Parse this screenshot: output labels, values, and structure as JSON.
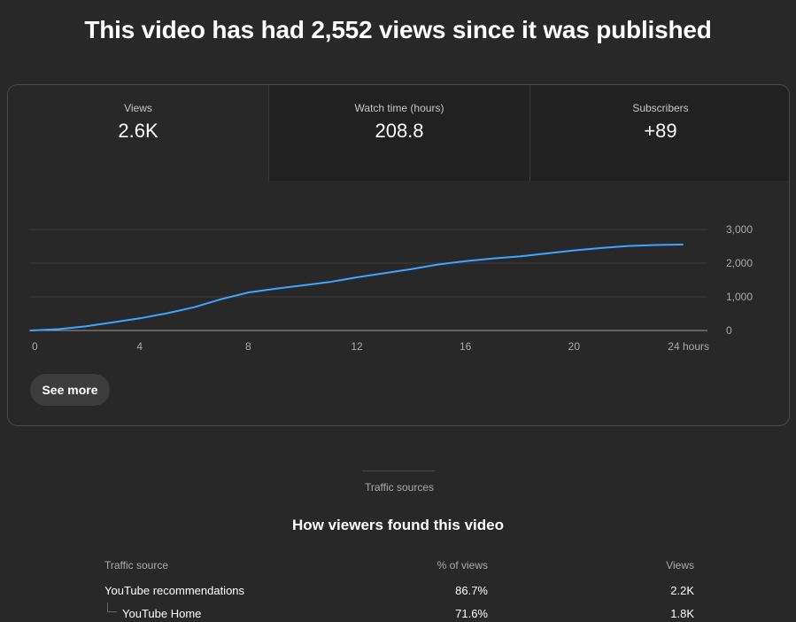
{
  "page_title": "This video has had 2,552 views since it was published",
  "metrics": [
    {
      "label": "Views",
      "value": "2.6K"
    },
    {
      "label": "Watch time (hours)",
      "value": "208.8"
    },
    {
      "label": "Subscribers",
      "value": "+89"
    }
  ],
  "see_more_label": "See more",
  "section_tab_label": "Traffic sources",
  "section_title": "How viewers found this video",
  "table": {
    "headers": [
      "Traffic source",
      "% of views",
      "Views"
    ],
    "rows": [
      {
        "source": "YouTube recommendations",
        "percent": "86.7%",
        "views": "2.2K",
        "indent": false
      },
      {
        "source": "YouTube Home",
        "percent": "71.6%",
        "views": "1.8K",
        "indent": true
      }
    ]
  },
  "chart_data": {
    "type": "line",
    "x_tick_labels": [
      "0",
      "4",
      "8",
      "12",
      "16",
      "20",
      "24 hours"
    ],
    "y_tick_labels": [
      "3,000",
      "2,000",
      "1,000",
      "0"
    ],
    "xlim": [
      0,
      24
    ],
    "ylim": [
      0,
      3000
    ],
    "grid": true,
    "line_color": "#3ea6ff",
    "series": [
      {
        "x": [
          0,
          1,
          2,
          3,
          4,
          5,
          6,
          7,
          8,
          9,
          10,
          11,
          12,
          13,
          14,
          15,
          16,
          17,
          18,
          19,
          20,
          21,
          22,
          23,
          24
        ],
        "values": [
          0,
          40,
          120,
          240,
          360,
          510,
          690,
          930,
          1130,
          1240,
          1340,
          1440,
          1580,
          1700,
          1820,
          1960,
          2060,
          2140,
          2200,
          2290,
          2380,
          2450,
          2510,
          2540,
          2552
        ]
      }
    ]
  }
}
